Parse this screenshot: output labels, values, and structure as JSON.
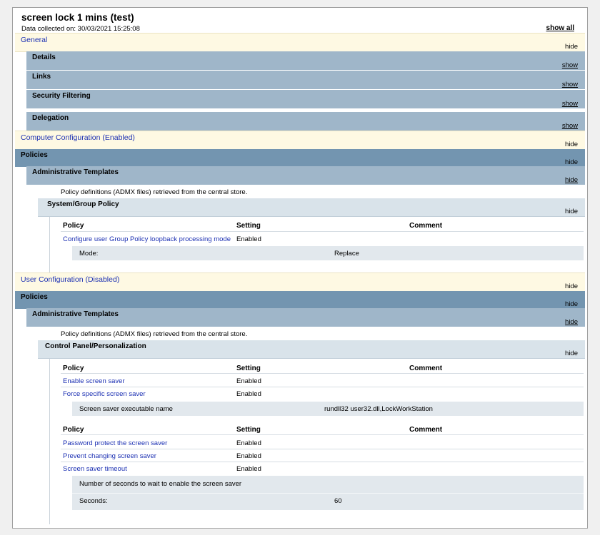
{
  "header": {
    "title": "screen lock 1 mins (test)",
    "collected": "Data collected on: 30/03/2021 15:25:08",
    "show_all": "show all"
  },
  "general": {
    "label": "General",
    "toggle": "hide",
    "subsections": [
      {
        "label": "Details",
        "toggle": "show"
      },
      {
        "label": "Links",
        "toggle": "show"
      },
      {
        "label": "Security Filtering",
        "toggle": "show"
      },
      {
        "label": "Delegation",
        "toggle": "show"
      }
    ]
  },
  "computer": {
    "label": "Computer Configuration (Enabled)",
    "toggle": "hide",
    "policies": {
      "label": "Policies",
      "toggle": "hide"
    },
    "admin": {
      "label": "Administrative Templates",
      "toggle": "hide",
      "note": "Policy definitions (ADMX files) retrieved from the central store."
    },
    "group": {
      "label": "System/Group Policy",
      "toggle": "hide"
    },
    "table": {
      "headers": [
        "Policy",
        "Setting",
        "Comment"
      ],
      "rows": [
        {
          "policy": "Configure user Group Policy loopback processing mode",
          "setting": "Enabled"
        }
      ],
      "sub": {
        "label": "Mode:",
        "value": "Replace"
      }
    }
  },
  "user": {
    "label": "User Configuration (Disabled)",
    "toggle": "hide",
    "policies": {
      "label": "Policies",
      "toggle": "hide"
    },
    "admin": {
      "label": "Administrative Templates",
      "toggle": "hide",
      "note": "Policy definitions (ADMX files) retrieved from the central store."
    },
    "group": {
      "label": "Control Panel/Personalization",
      "toggle": "hide"
    },
    "table1": {
      "headers": [
        "Policy",
        "Setting",
        "Comment"
      ],
      "rows": [
        {
          "policy": "Enable screen saver",
          "setting": "Enabled"
        },
        {
          "policy": "Force specific screen saver",
          "setting": "Enabled"
        }
      ],
      "sub": {
        "label": "Screen saver executable name",
        "value": "rundll32 user32.dll,LockWorkStation"
      }
    },
    "table2": {
      "headers": [
        "Policy",
        "Setting",
        "Comment"
      ],
      "rows": [
        {
          "policy": "Password protect the screen saver",
          "setting": "Enabled"
        },
        {
          "policy": "Prevent changing screen saver",
          "setting": "Enabled"
        },
        {
          "policy": "Screen saver timeout",
          "setting": "Enabled"
        }
      ],
      "sub": {
        "heading": "Number of seconds to wait to enable the screen saver",
        "label": "Seconds:",
        "value": "60"
      }
    }
  }
}
